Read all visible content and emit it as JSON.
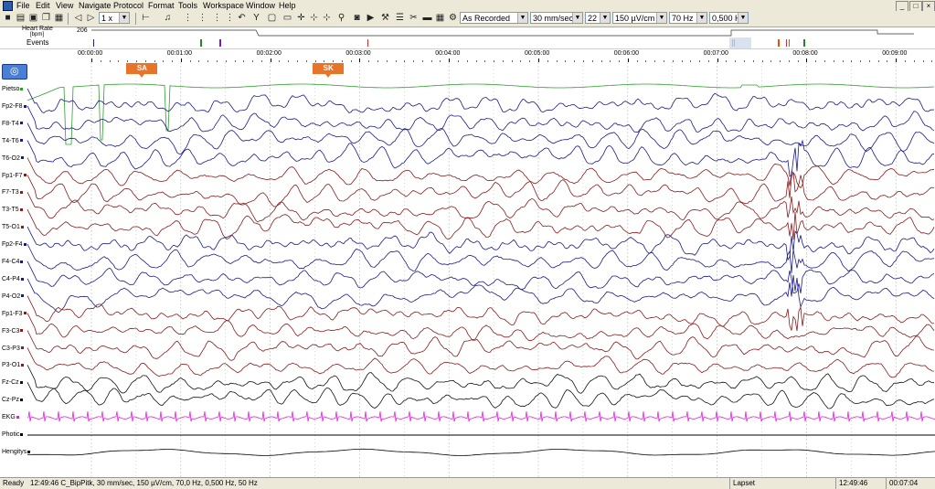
{
  "menu": [
    "File",
    "Edit",
    "View",
    "Navigate",
    "Protocol",
    "Format",
    "Tools",
    "Workspace",
    "Window",
    "Help"
  ],
  "window_buttons": [
    "_",
    "□",
    "×"
  ],
  "toolbar": {
    "speed_label": "1 x",
    "montage": "As Recorded",
    "paper_speed": "30 mm/sec",
    "channels": "22",
    "sensitivity": "150 µV/cm",
    "high_filter": "70 Hz",
    "low_filter": "0,500 H"
  },
  "overview": {
    "heart_rate_label": "Heart Rate",
    "heart_rate_value": "206",
    "heart_rate_sub": "[bpm]",
    "events_label": "Events",
    "event_marks": [
      {
        "time_s": 1,
        "color": "#1a237e"
      },
      {
        "time_s": 73,
        "color": "#2e7d32"
      },
      {
        "time_s": 86,
        "color": "#7b1fa2"
      },
      {
        "time_s": 185,
        "color": "#d32f2f"
      },
      {
        "time_s": 430,
        "color": "#e65100"
      },
      {
        "time_s": 431,
        "color": "#e65100"
      },
      {
        "time_s": 461,
        "color": "#e65100"
      },
      {
        "time_s": 466,
        "color": "#d32f2f"
      },
      {
        "time_s": 468,
        "color": "#e65100"
      },
      {
        "time_s": 478,
        "color": "#2e7d32"
      }
    ],
    "overview_total_s": 530
  },
  "timeline": {
    "ticks": [
      "00:00:00",
      "00:01:00",
      "00:02:00",
      "00:03:00",
      "00:04:00",
      "00:05:00",
      "00:06:00",
      "00:07:00",
      "00:08:00",
      "00:09:00"
    ]
  },
  "annotations": [
    {
      "label": "SA",
      "at_s": 34
    },
    {
      "label": "SK",
      "at_s": 159
    }
  ],
  "channels": [
    {
      "name": "Pietso",
      "color": "#2e9e2e",
      "marker": "#2e9e2e"
    },
    {
      "name": "Fp2-F8",
      "color": "#1a1a8c",
      "marker": "#1a1a8c"
    },
    {
      "name": "F8-T4",
      "color": "#1a1a8c",
      "marker": "#1a1a8c"
    },
    {
      "name": "T4-T6",
      "color": "#1a1a8c",
      "marker": "#1a1a8c"
    },
    {
      "name": "T6-O2",
      "color": "#1a1a8c",
      "marker": "#1a1a8c"
    },
    {
      "name": "Fp1-F7",
      "color": "#8b1a1a",
      "marker": "#8b1a1a"
    },
    {
      "name": "F7-T3",
      "color": "#8b1a1a",
      "marker": "#8b1a1a"
    },
    {
      "name": "T3-T5",
      "color": "#8b1a1a",
      "marker": "#8b1a1a"
    },
    {
      "name": "T5-O1",
      "color": "#8b1a1a",
      "marker": "#8b1a1a"
    },
    {
      "name": "Fp2-F4",
      "color": "#1a1a8c",
      "marker": "#1a1a8c"
    },
    {
      "name": "F4-C4",
      "color": "#1a1a8c",
      "marker": "#1a1a8c"
    },
    {
      "name": "C4-P4",
      "color": "#1a1a8c",
      "marker": "#1a1a8c"
    },
    {
      "name": "P4-O2",
      "color": "#1a1a8c",
      "marker": "#1a1a8c"
    },
    {
      "name": "Fp1-F3",
      "color": "#8b1a1a",
      "marker": "#8b1a1a"
    },
    {
      "name": "F3-C3",
      "color": "#8b1a1a",
      "marker": "#8b1a1a"
    },
    {
      "name": "C3-P3",
      "color": "#8b1a1a",
      "marker": "#8b1a1a"
    },
    {
      "name": "P3-O1",
      "color": "#8b1a1a",
      "marker": "#8b1a1a"
    },
    {
      "name": "Fz-Cz",
      "color": "#111111",
      "marker": "#111111"
    },
    {
      "name": "Cz-Pz",
      "color": "#111111",
      "marker": "#111111"
    },
    {
      "name": "EKG",
      "color": "#e020e0",
      "marker": "#e020e0"
    },
    {
      "name": "Photic",
      "color": "#000000",
      "marker": "#000000"
    },
    {
      "name": "Hengitys",
      "color": "#000000",
      "marker": "#000000"
    }
  ],
  "status": {
    "left": "Ready",
    "info": "12:49:46 C_BipPitk, 30 mm/sec, 150 µV/cm, 70,0 Hz, 0,500 Hz, 50 Hz",
    "mode": "Lapset",
    "clock": "12:49:46",
    "position": "00:07:04"
  },
  "colors": {
    "accent": "#3a6fd0",
    "annotation": "#e8742a"
  }
}
